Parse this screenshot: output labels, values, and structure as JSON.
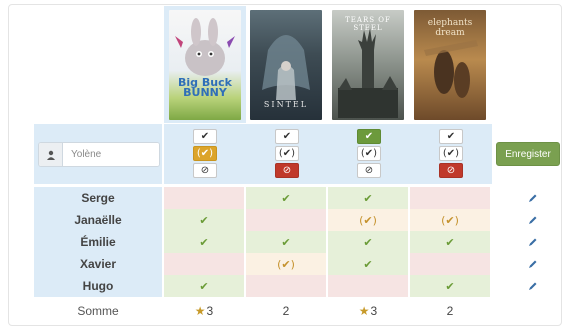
{
  "posters": [
    {
      "title": "Big Buck BUNNY",
      "name": "big-buck-bunny"
    },
    {
      "title": "SINTEL",
      "name": "sintel"
    },
    {
      "title": "TEARS OF STEEL",
      "name": "tears-of-steel"
    },
    {
      "title": "elephants dream",
      "name": "elephants-dream"
    }
  ],
  "new_vote": {
    "name_placeholder": "Yolène",
    "save_label": "Enregister",
    "columns": [
      {
        "yes": "✔",
        "maybe": "(✔)",
        "no": "⊘",
        "selected": "maybe"
      },
      {
        "yes": "✔",
        "maybe": "(✔)",
        "no": "⊘",
        "selected": "no"
      },
      {
        "yes": "✔",
        "maybe": "(✔)",
        "no": "⊘",
        "selected": "yes"
      },
      {
        "yes": "✔",
        "maybe": "(✔)",
        "no": "⊘",
        "selected": "no"
      }
    ]
  },
  "participants": [
    {
      "name": "Serge",
      "votes": [
        "no",
        "yes",
        "yes",
        "no"
      ]
    },
    {
      "name": "Janaëlle",
      "votes": [
        "yes",
        "no",
        "maybe",
        "maybe"
      ]
    },
    {
      "name": "Émilie",
      "votes": [
        "yes",
        "yes",
        "yes",
        "yes"
      ]
    },
    {
      "name": "Xavier",
      "votes": [
        "no",
        "maybe",
        "yes",
        "no"
      ]
    },
    {
      "name": "Hugo",
      "votes": [
        "yes",
        "no",
        "no",
        "yes"
      ]
    }
  ],
  "vote_symbols": {
    "yes": "✔",
    "maybe": "(✔)",
    "no": ""
  },
  "summary": {
    "label": "Somme",
    "totals": [
      "3",
      "2",
      "3",
      "2"
    ],
    "starred": [
      true,
      false,
      true,
      false
    ]
  },
  "colors": {
    "yes": "#6c9a3c",
    "maybe": "#dca42a",
    "no": "#c0392b",
    "save": "#7aa050",
    "header_bg": "#dcebf7"
  }
}
